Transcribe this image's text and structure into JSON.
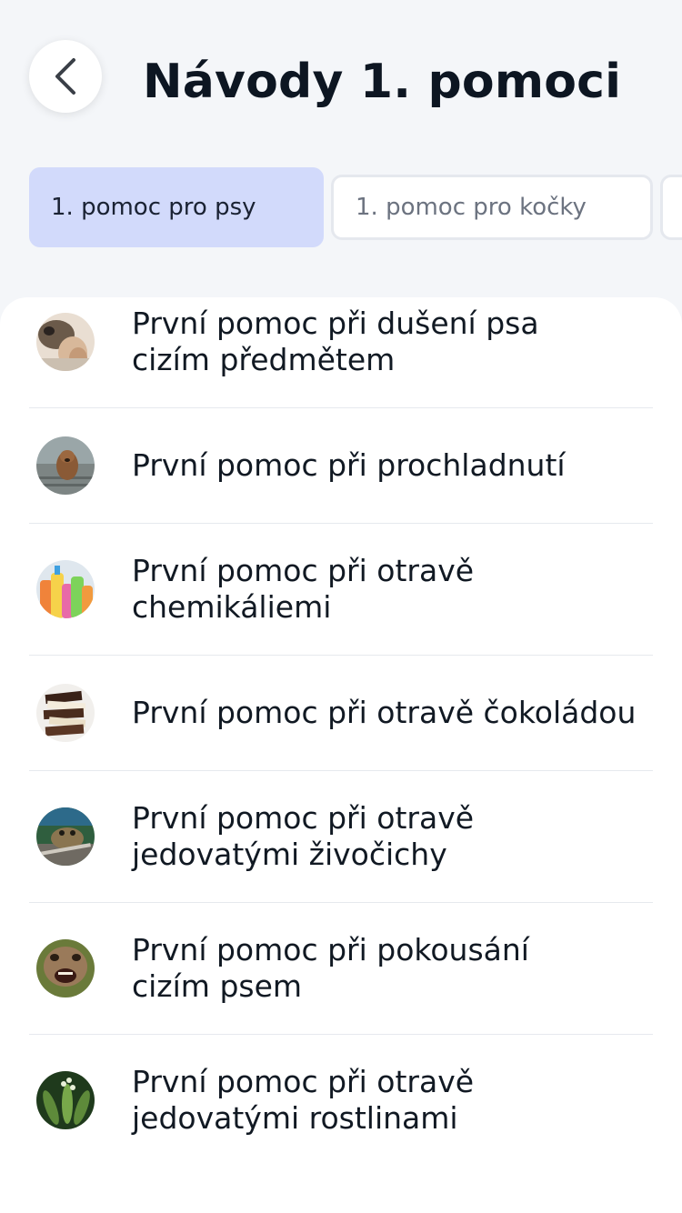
{
  "header": {
    "title": "Návody 1. pomoci"
  },
  "tabs": [
    {
      "label": "1. pomoc pro psy",
      "active": true
    },
    {
      "label": "1. pomoc pro kočky",
      "active": false
    }
  ],
  "items": [
    {
      "line1": "První pomoc při dušení psa",
      "line2": "cizím předmětem",
      "icon": "dog-choking-photo"
    },
    {
      "line1": "První pomoc při prochladnutí",
      "line2": "",
      "icon": "wet-dog-photo"
    },
    {
      "line1": "První pomoc při otravě",
      "line2": "chemikáliemi",
      "icon": "cleaning-chemicals-photo"
    },
    {
      "line1": "První pomoc při otravě čokoládou",
      "line2": "",
      "icon": "chocolate-photo"
    },
    {
      "line1": "První pomoc při otravě",
      "line2": "jedovatými živočichy",
      "icon": "toad-photo"
    },
    {
      "line1": "První pomoc při pokousání",
      "line2": "cizím psem",
      "icon": "aggressive-dog-photo"
    },
    {
      "line1": "První pomoc při otravě",
      "line2": "jedovatými rostlinami",
      "icon": "poisonous-plant-photo"
    }
  ],
  "colors": {
    "background": "#f4f6f9",
    "active_tab": "#d2dafb",
    "text": "#0d1622",
    "muted": "#6c7380"
  }
}
